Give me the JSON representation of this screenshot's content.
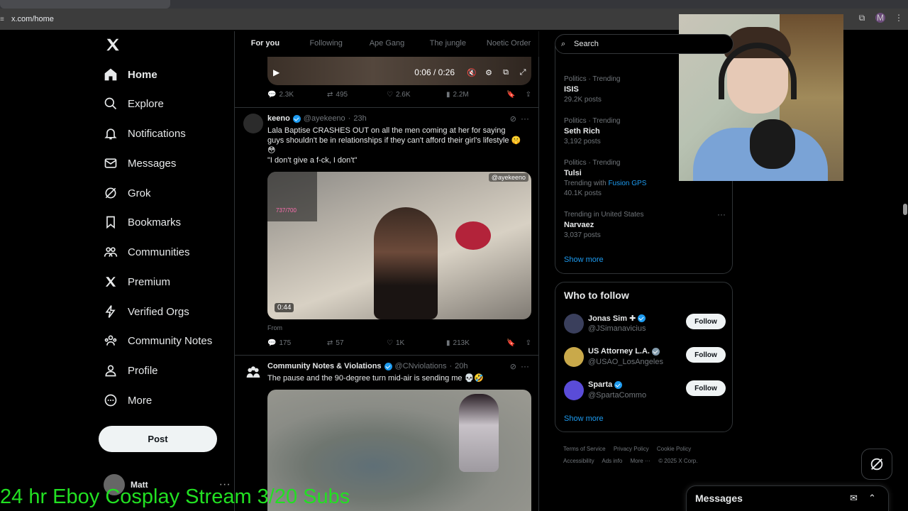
{
  "browser": {
    "url": "x.com/home"
  },
  "nav": {
    "items": [
      {
        "label": "Home",
        "icon": "home-icon"
      },
      {
        "label": "Explore",
        "icon": "search-icon"
      },
      {
        "label": "Notifications",
        "icon": "bell-icon"
      },
      {
        "label": "Messages",
        "icon": "envelope-icon"
      },
      {
        "label": "Grok",
        "icon": "grok-icon"
      },
      {
        "label": "Bookmarks",
        "icon": "bookmark-icon"
      },
      {
        "label": "Communities",
        "icon": "people-icon"
      },
      {
        "label": "Premium",
        "icon": "x-logo-icon"
      },
      {
        "label": "Verified Orgs",
        "icon": "lightning-icon"
      },
      {
        "label": "Community Notes",
        "icon": "community-notes-icon"
      },
      {
        "label": "Profile",
        "icon": "person-icon"
      },
      {
        "label": "More",
        "icon": "more-circle-icon"
      }
    ],
    "post_label": "Post",
    "account_name": "Matt"
  },
  "feed": {
    "tabs": [
      "For you",
      "Following",
      "Ape Gang",
      "The jungle",
      "Noetic Order"
    ],
    "video_time": "0:06 / 0:26",
    "first_stats": {
      "replies": "2.3K",
      "reposts": "495",
      "likes": "2.6K",
      "views": "2.2M"
    },
    "tweet1": {
      "name": "keeno",
      "handle": "@ayekeeno",
      "time": "23h",
      "text": "Lala Baptise CRASHES OUT on all the men coming at her for saying guys shouldn't be in relationships if they can't afford their girl's lifestyle 🤫😳",
      "quote": "\"I don't give a f-ck, I don't\"",
      "media_watermark": "@ayekeeno",
      "media_counter": "737/700",
      "duration": "0:44",
      "from": "From",
      "stats": {
        "replies": "175",
        "reposts": "57",
        "likes": "1K",
        "views": "213K"
      }
    },
    "tweet2": {
      "name": "Community Notes & Violations",
      "handle": "@CNviolations",
      "time": "20h",
      "text": "The pause and the 90-degree turn mid-air is sending me 💀🤣"
    }
  },
  "sidebar": {
    "search_placeholder": "Search",
    "trends": [
      {
        "category": "Politics · Trending",
        "name": "ISIS",
        "posts": "29.2K posts"
      },
      {
        "category": "Politics · Trending",
        "name": "Seth Rich",
        "posts": "3,192 posts"
      },
      {
        "category": "Politics · Trending",
        "name": "Tulsi",
        "posts_prefix": "Trending with",
        "posts_link": "Fusion GPS",
        "posts": "40.1K posts"
      },
      {
        "category": "Trending in United States",
        "name": "Narvaez",
        "posts": "3,037 posts"
      }
    ],
    "show_more": "Show more",
    "who_to_follow": "Who to follow",
    "follow_accounts": [
      {
        "name": "Jonas Sim ✚",
        "handle": "@JSimanavicius",
        "color": "#3a3f5c"
      },
      {
        "name": "US Attorney L.A.",
        "handle": "@USAO_LosAngeles",
        "color": "#c9a94a"
      },
      {
        "name": "Sparta",
        "handle": "@SpartaCommo",
        "color": "#5a4cd8"
      }
    ],
    "follow_label": "Follow",
    "footer": [
      "Terms of Service",
      "Privacy Policy",
      "Cookie Policy",
      "Accessibility",
      "Ads info",
      "More ···",
      "© 2025 X Corp."
    ]
  },
  "messages_drawer": {
    "title": "Messages"
  },
  "overlay": {
    "text": "24 hr Eboy Cosplay Stream 3/20 Subs"
  }
}
